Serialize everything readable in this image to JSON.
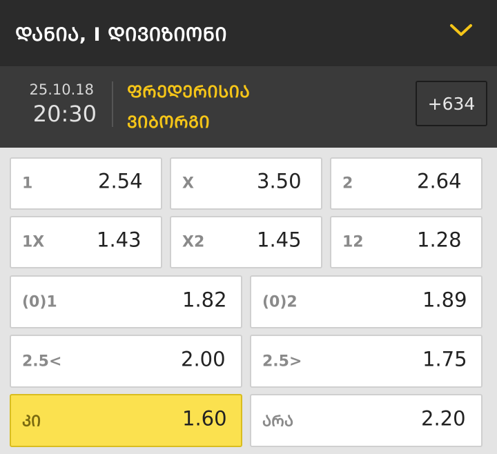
{
  "header": {
    "title": "ᲓᲐᲜᲘᲐ, I ᲓᲘᲕᲘᲖᲘᲝᲜᲘ",
    "icon": "chevron-down-icon",
    "accent": "#f5c518"
  },
  "match": {
    "date": "25.10.18",
    "time": "20:30",
    "home": "ᲤᲠᲔᲓᲔᲠᲘᲡᲘᲐ",
    "away": "ᲕᲘᲑᲝᲠᲒᲘ",
    "more": "+634"
  },
  "odds": {
    "r1": [
      {
        "label": "1",
        "odds": "2.54"
      },
      {
        "label": "X",
        "odds": "3.50"
      },
      {
        "label": "2",
        "odds": "2.64"
      }
    ],
    "r2": [
      {
        "label": "1X",
        "odds": "1.43"
      },
      {
        "label": "X2",
        "odds": "1.45"
      },
      {
        "label": "12",
        "odds": "1.28"
      }
    ],
    "r3": [
      {
        "label": "(0)1",
        "odds": "1.82"
      },
      {
        "label": "(0)2",
        "odds": "1.89"
      }
    ],
    "r4": [
      {
        "label": "2.5<",
        "odds": "2.00"
      },
      {
        "label": "2.5>",
        "odds": "1.75"
      }
    ],
    "r5": [
      {
        "label": "ᲙᲘ",
        "odds": "1.60",
        "selected": true
      },
      {
        "label": "ᲐᲠᲐ",
        "odds": "2.20"
      }
    ]
  }
}
